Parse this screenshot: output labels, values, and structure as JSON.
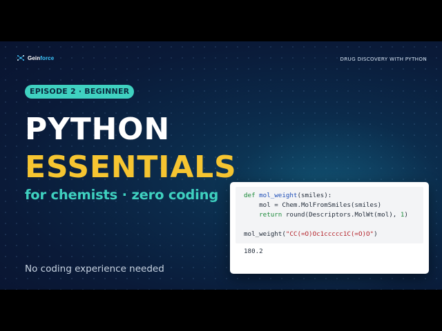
{
  "brand": {
    "logo_prefix": "Gein",
    "logo_suffix": "force",
    "accent_color": "#3ec8ff"
  },
  "series_label": "DRUG DISCOVERY WITH PYTHON",
  "episode_badge": "EPISODE 2 · BEGINNER",
  "title_line_1": "PYTHON",
  "title_line_2": "ESSENTIALS",
  "subtitle": "for chemists · zero coding",
  "tagline": "No coding experience needed",
  "code": {
    "line1_kw": "def ",
    "line1_fn": "mol_weight",
    "line1_rest": "(smiles):",
    "line2_indent": "    ",
    "line2_text": "mol = Chem.MolFromSmiles(smiles)",
    "line3_indent": "    ",
    "line3_kw": "return ",
    "line3_rest_a": "round(Descriptors.MolWt(mol), ",
    "line3_num": "1",
    "line3_rest_b": ")",
    "line5_fn": "mol_weight(",
    "line5_str": "\"CC(=O)Oc1ccccc1C(=O)O\"",
    "line5_end": ")",
    "output": "180.2"
  },
  "colors": {
    "title_primary": "#ffffff",
    "title_secondary": "#f6c531",
    "teal_accent": "#3fd1c0",
    "background": "#0a1f3f"
  },
  "icons": {
    "logo": "geinforce-logo-icon"
  }
}
